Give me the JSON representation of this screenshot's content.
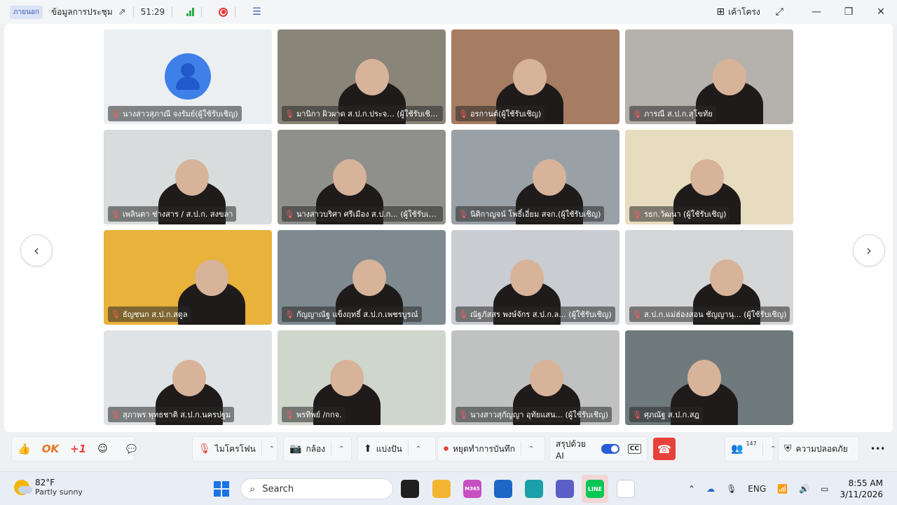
{
  "titlebar": {
    "ext_badge": "ภายนอก",
    "meeting_title": "ข้อมูลการประชุม",
    "timer": "51:29",
    "layout_label": "เค้าโครง"
  },
  "participants": [
    {
      "name": "นางสาวสุภาณี จงรัมย์(ผู้ใช้รับเชิญ)",
      "bg": "#eceff2",
      "avatar": true
    },
    {
      "name": "มานิกา ผิวผาด ส.ป.ก.ประจ... (ผู้ใช้รับเชิญ)",
      "bg": "#8a8579"
    },
    {
      "name": "อรกานต์(ผู้ใช้รับเชิญ)",
      "bg": "#a67c62"
    },
    {
      "name": "ภารณี ส.ป.ก.สุโขทัย",
      "bg": "#b5b1ad"
    },
    {
      "name": "เพลินตา ช่างสาร / ส.ป.ก. สงขลา",
      "bg": "#d9dcdc"
    },
    {
      "name": "นางสาวบริศา ศรีเมือง ส.ป.ก... (ผู้ใช้รับเชิญ)",
      "bg": "#8f8f8b"
    },
    {
      "name": "นิติกาญจน์ โพธิ์เอี่ยม สจก.(ผู้ใช้รับเชิญ)",
      "bg": "#9aa1a6"
    },
    {
      "name": "รธก.วัฒนา (ผู้ใช้รับเชิญ)",
      "bg": "#e8dcc0"
    },
    {
      "name": "ธัญชนก ส.ป.ก.สตูล",
      "bg": "#e8b23b"
    },
    {
      "name": "กัญญาณัฐ แข็งฤทธิ์ ส.ป.ก.เพชรบูรณ์",
      "bg": "#7e8a8f"
    },
    {
      "name": "ณัฐภัสสร พงษ์จักร ส.ป.ก.ล... (ผู้ใช้รับเชิญ)",
      "bg": "#c9cdd1"
    },
    {
      "name": "ส.ป.ก.แม่ฮ่องสอน ชัญญานุ... (ผู้ใช้รับเชิญ)",
      "bg": "#d4d6d8"
    },
    {
      "name": "สุภาพร พุทธชาติ ส.ป.ก.นครปฐม",
      "bg": "#dfe3e6"
    },
    {
      "name": "พรทิพย์ /กกจ.",
      "bg": "#cfd6cc"
    },
    {
      "name": "นางสาวสุกัญญา อุทัยแสน... (ผู้ใช้รับเชิญ)",
      "bg": "#bfc2c0"
    },
    {
      "name": "ศุภณัฐ ส.ป.ก.สฎ",
      "bg": "#6f7a7c"
    }
  ],
  "toolbar": {
    "reaction_ok": "OK",
    "reaction_plus": "+1",
    "mic_label": "ไมโครโฟน",
    "camera_label": "กล้อง",
    "share_label": "แบ่งปัน",
    "stop_record_label": "หยุดทำการบันทึก",
    "ai_summary_label": "สรุปด้วย AI",
    "cc_label": "CC",
    "participant_count": "147",
    "security_label": "ความปลอดภัย"
  },
  "taskbar": {
    "temperature": "82°F",
    "condition": "Partly sunny",
    "search_placeholder": "Search",
    "language": "ENG",
    "time": "8:55 AM",
    "date": "3/11/2026",
    "m365_label": "M365",
    "line_label": "LINE"
  },
  "colors": {
    "accent": "#2a5bd7",
    "hangup": "#e8413c",
    "muted_mic": "#ff5a5a"
  }
}
